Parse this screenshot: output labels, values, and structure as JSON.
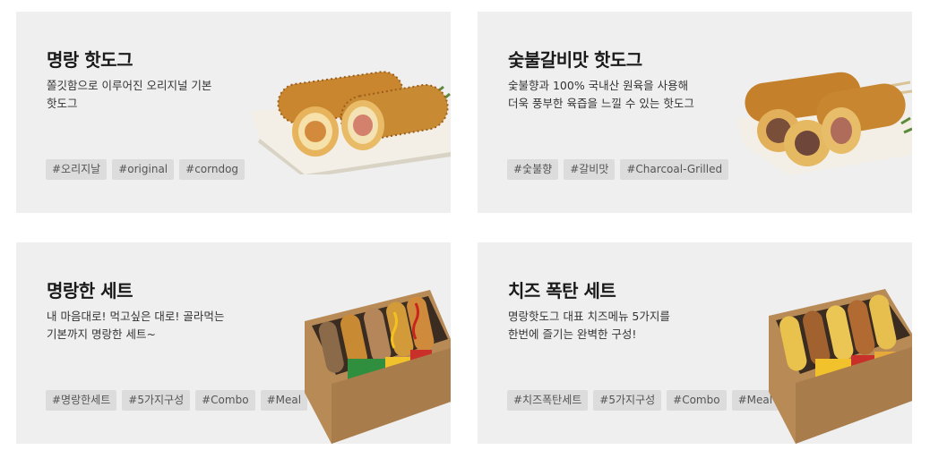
{
  "cards": [
    {
      "title": "명랑 핫도그",
      "desc": [
        "쫄깃함으로 이루어진 오리지널 기본",
        "핫도그"
      ],
      "tags": [
        "#오리지날",
        "#original",
        "#corndog"
      ]
    },
    {
      "title": "숯불갈비맛 핫도그",
      "desc": [
        "숯불향과 100% 국내산 원육을 사용해",
        "더욱 풍부한 육즙을 느낄 수 있는 핫도그"
      ],
      "tags": [
        "#숯불향",
        "#갈비맛",
        "#Charcoal-Grilled"
      ]
    },
    {
      "title": "명랑한 세트",
      "desc": [
        "내 마음대로! 먹고싶은 대로! 골라먹는",
        "기본까지 명랑한 세트~"
      ],
      "tags": [
        "#명랑한세트",
        "#5가지구성",
        "#Combo",
        "#Meal"
      ]
    },
    {
      "title": "치즈 폭탄 세트",
      "desc": [
        "명랑핫도그 대표 치즈메뉴 5가지를",
        "한번에 즐기는 완벽한 구성!"
      ],
      "tags": [
        "#치즈폭탄세트",
        "#5가지구성",
        "#Combo",
        "#Meal"
      ]
    }
  ]
}
